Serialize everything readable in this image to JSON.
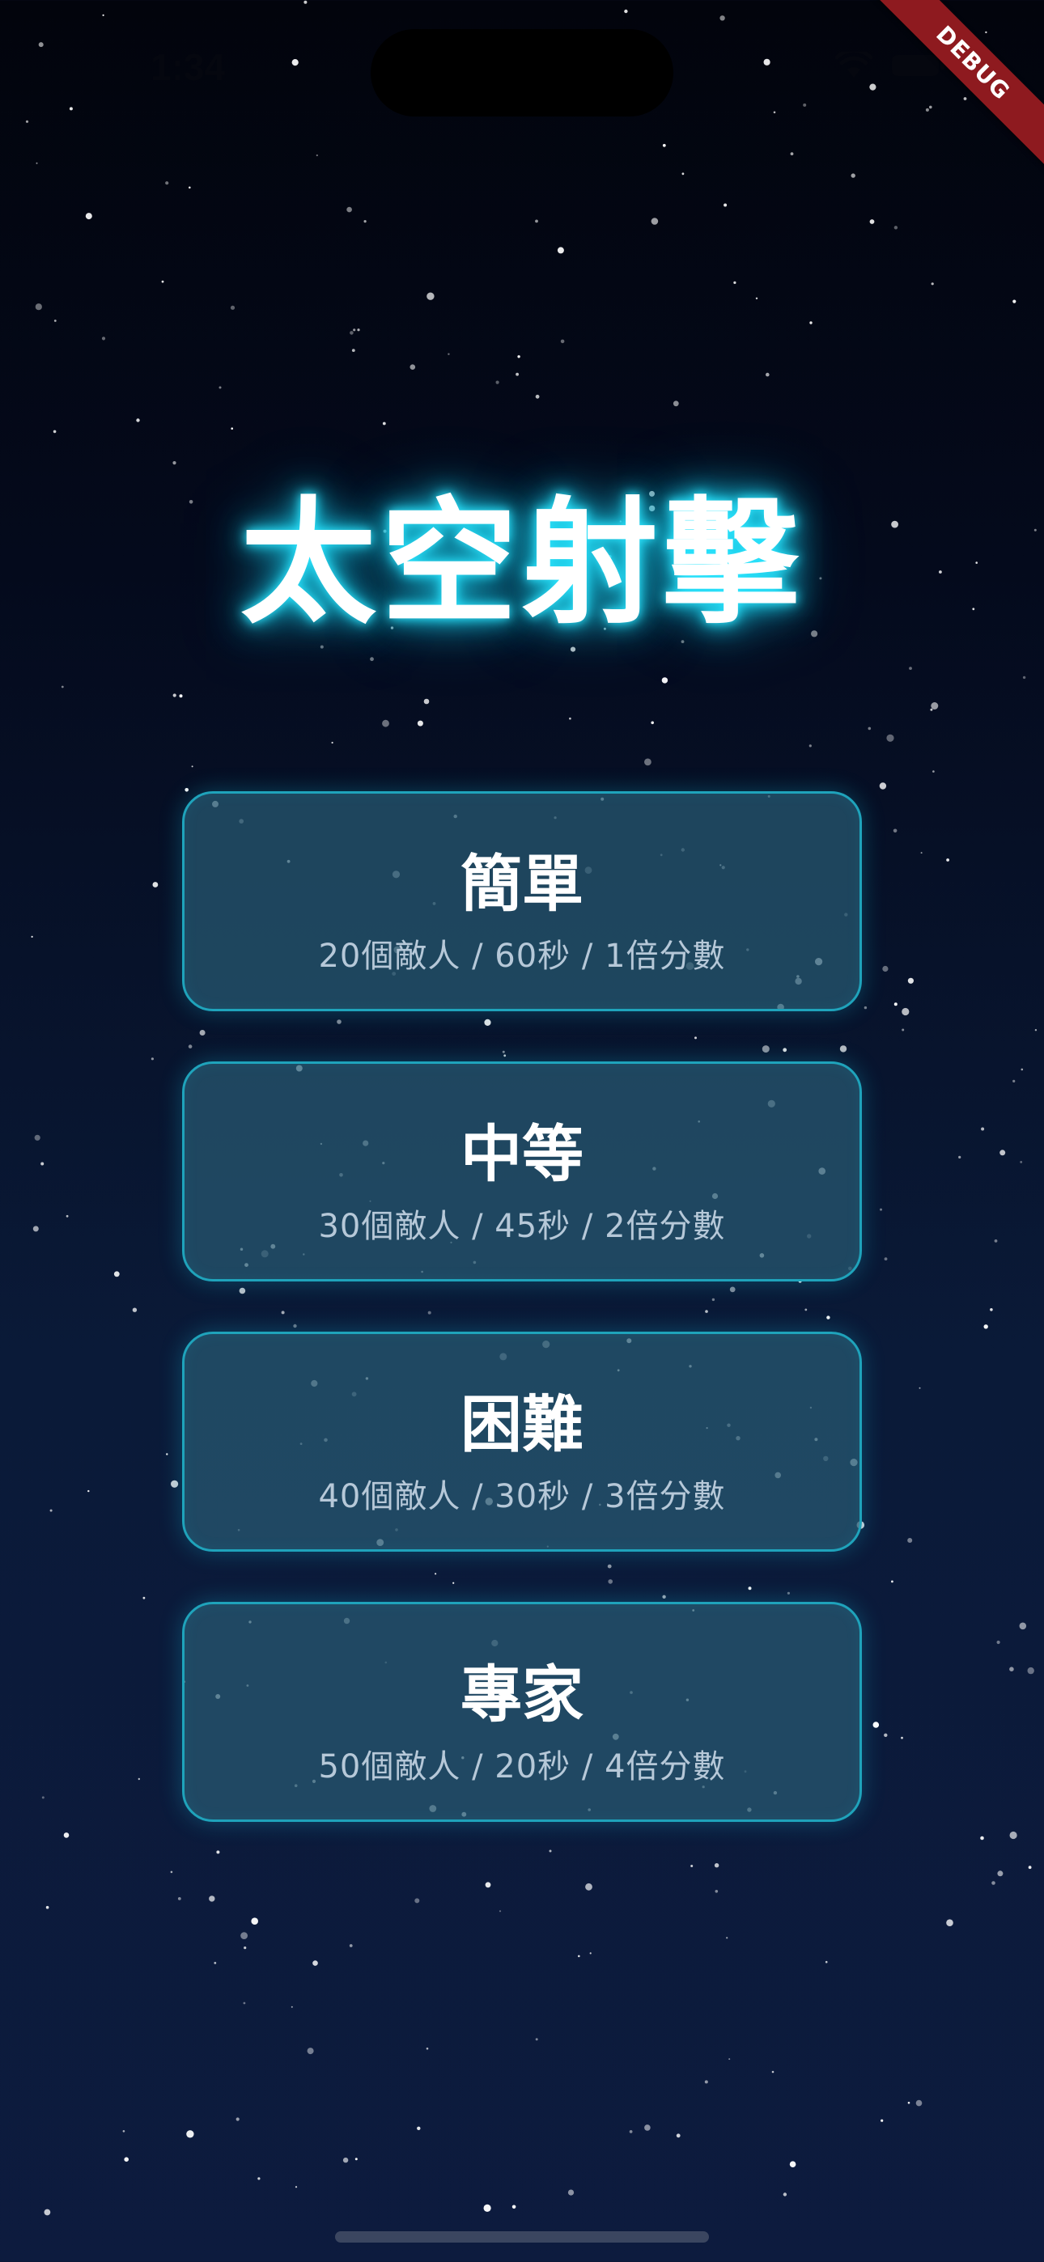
{
  "status_bar": {
    "time": "1:34",
    "wifi_icon": "wifi-icon",
    "battery_icon": "battery-icon"
  },
  "debug_banner": {
    "label": "DEBUG"
  },
  "title": "太空射擊",
  "levels": [
    {
      "name": "簡單",
      "description": "20個敵人 / 60秒 / 1倍分數"
    },
    {
      "name": "中等",
      "description": "30個敵人 / 45秒 / 2倍分數"
    },
    {
      "name": "困難",
      "description": "40個敵人 / 30秒 / 3倍分數"
    },
    {
      "name": "專家",
      "description": "50個敵人 / 20秒 / 4倍分數"
    }
  ],
  "colors": {
    "background_top": "#02040c",
    "background_bottom": "#0d1b3e",
    "accent_glow": "#1ccde8",
    "card_border": "#1fa3bb",
    "card_fill": "#285a73",
    "debug_red": "#8e1a1f"
  }
}
